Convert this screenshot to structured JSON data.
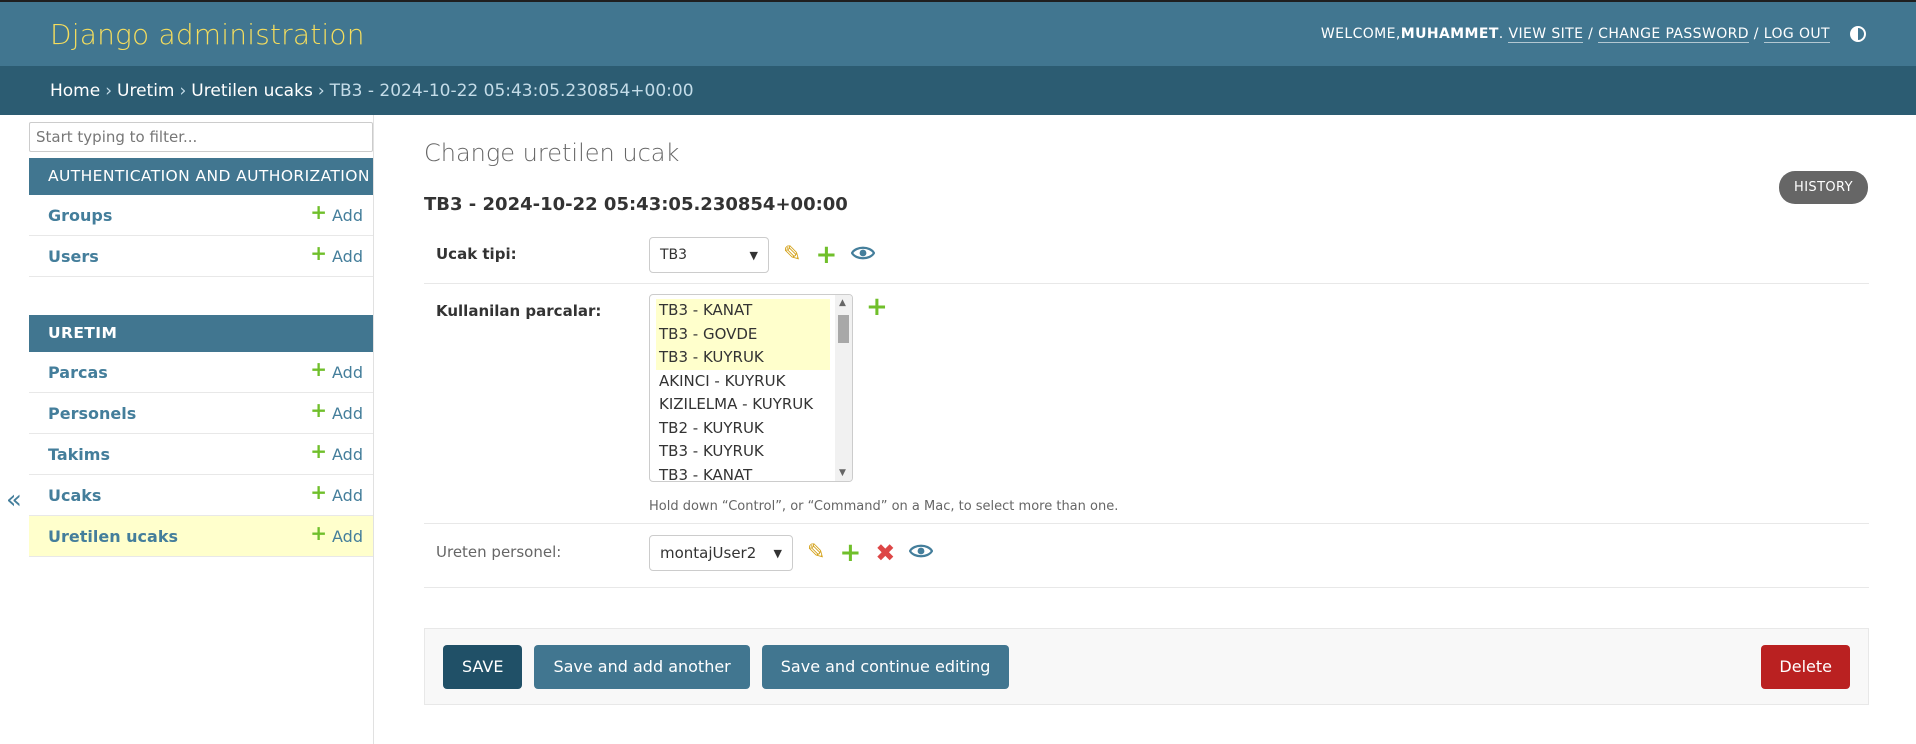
{
  "header": {
    "branding": "Django administration",
    "welcome": "WELCOME, ",
    "username": "MUHAMMET",
    "view_site": "VIEW SITE",
    "change_password": "CHANGE PASSWORD",
    "log_out": "LOG OUT",
    "separator": " / "
  },
  "breadcrumbs": {
    "items": [
      "Home",
      "Uretim",
      "Uretilen ucaks"
    ],
    "current": "TB3 - 2024-10-22 05:43:05.230854+00:00",
    "separator": "›"
  },
  "sidebar": {
    "filter_placeholder": "Start typing to filter...",
    "add_label": "Add",
    "toggle_glyph": "«",
    "modules": [
      {
        "caption": "AUTHENTICATION AND AUTHORIZATION",
        "models": [
          "Groups",
          "Users"
        ]
      },
      {
        "caption": "URETIM",
        "models": [
          "Parcas",
          "Personels",
          "Takims",
          "Ucaks",
          "Uretilen ucaks"
        ]
      }
    ],
    "current_model": "Uretilen ucaks"
  },
  "content": {
    "title": "Change uretilen ucak",
    "object_heading": "TB3 - 2024-10-22 05:43:05.230854+00:00",
    "history_label": "HISTORY",
    "fields": {
      "ucak_tipi": {
        "label": "Ucak tipi:",
        "value": "TB3"
      },
      "kullanilan_parcalar": {
        "label": "Kullanilan parcalar:",
        "options": [
          {
            "text": "TB3 - KANAT",
            "selected": true
          },
          {
            "text": "TB3 - GOVDE",
            "selected": true
          },
          {
            "text": "TB3 - KUYRUK",
            "selected": true
          },
          {
            "text": "AKINCI - KUYRUK",
            "selected": false
          },
          {
            "text": "KIZILELMA - KUYRUK",
            "selected": false
          },
          {
            "text": "TB2 - KUYRUK",
            "selected": false
          },
          {
            "text": "TB3 - KUYRUK",
            "selected": false
          },
          {
            "text": "TB3 - KANAT",
            "selected": false
          }
        ],
        "help": "Hold down “Control”, or “Command” on a Mac, to select more than one."
      },
      "ureten_personel": {
        "label": "Ureten personel:",
        "value": "montajUser2"
      }
    },
    "buttons": {
      "save": "SAVE",
      "save_add_another": "Save and add another",
      "save_continue": "Save and continue editing",
      "delete": "Delete"
    }
  },
  "colors": {
    "header_bg": "#417690",
    "branding": "#f5dd5d",
    "breadcrumbs_bg": "#2c5c72",
    "link": "#447e9b",
    "add_green": "#70bf2b",
    "delete_red": "#ba2121",
    "selected_row": "#ffffcc"
  },
  "icons": {
    "edit": "pencil-icon",
    "add": "plus-icon",
    "delete": "x-icon",
    "view": "eye-icon",
    "theme": "half-circle-icon"
  }
}
